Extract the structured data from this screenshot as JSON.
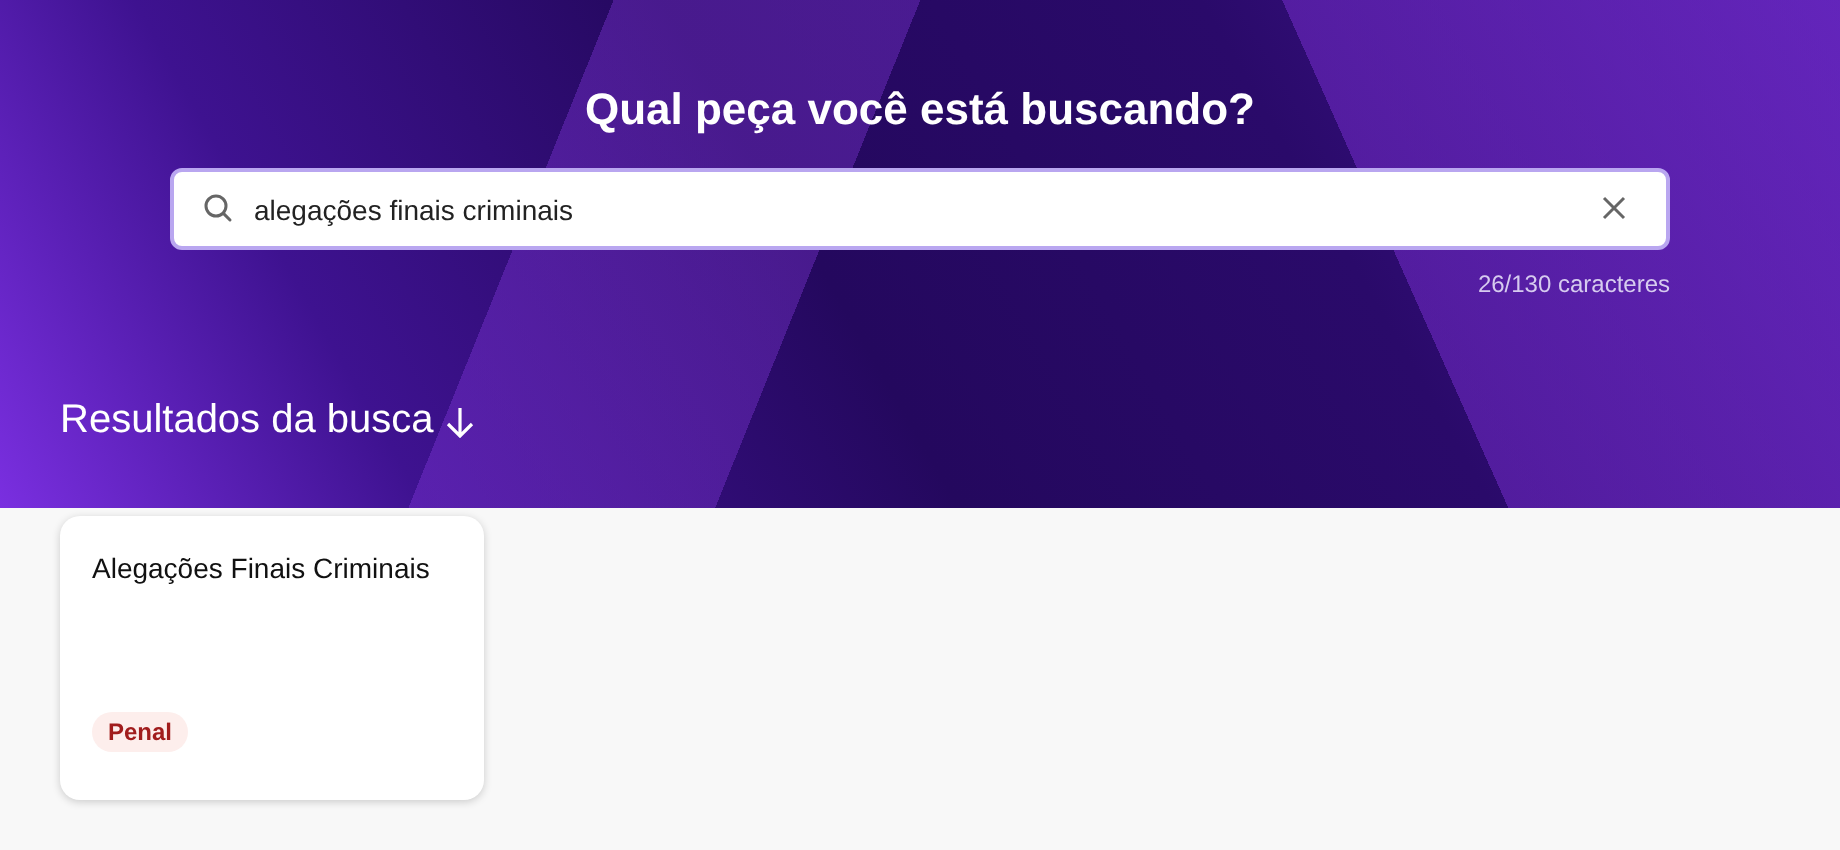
{
  "header": {
    "title": "Qual peça você está buscando?"
  },
  "search": {
    "value": "alegações finais criminais",
    "counter": "26/130 caracteres"
  },
  "results": {
    "heading": "Resultados da busca",
    "cards": [
      {
        "title": "Alegações Finais Criminais",
        "tag": "Penal"
      }
    ]
  }
}
